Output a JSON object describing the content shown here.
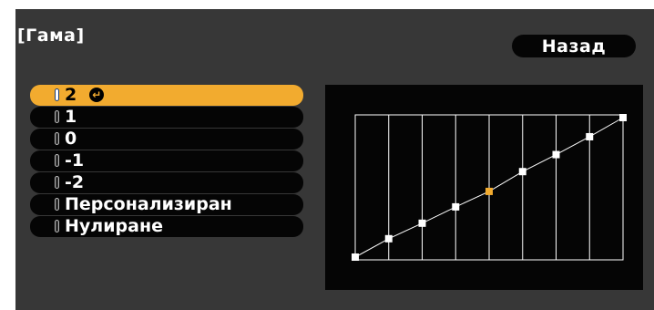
{
  "title": "[Гама]",
  "back_label": "Назад",
  "menu": {
    "items": [
      {
        "label": "2",
        "selected": true
      },
      {
        "label": "1",
        "selected": false
      },
      {
        "label": "0",
        "selected": false
      },
      {
        "label": "-1",
        "selected": false
      },
      {
        "label": "-2",
        "selected": false
      },
      {
        "label": "Персонализиран",
        "selected": false
      },
      {
        "label": "Нулиране",
        "selected": false
      }
    ]
  },
  "icons": {
    "enter": "enter-return-icon"
  },
  "colors": {
    "selected": "#f2ab2f",
    "background": "#373737",
    "item": "#050505",
    "active_point": "#f2ab2f"
  },
  "gamma_graph": {
    "columns": 8,
    "points": [
      {
        "x": 0,
        "y": 0.0,
        "active": false
      },
      {
        "x": 1,
        "y": 0.132,
        "active": false
      },
      {
        "x": 2,
        "y": 0.243,
        "active": false
      },
      {
        "x": 3,
        "y": 0.36,
        "active": false
      },
      {
        "x": 4,
        "y": 0.471,
        "active": true
      },
      {
        "x": 5,
        "y": 0.613,
        "active": false
      },
      {
        "x": 6,
        "y": 0.735,
        "active": false
      },
      {
        "x": 7,
        "y": 0.863,
        "active": false
      },
      {
        "x": 8,
        "y": 1.0,
        "active": false
      }
    ]
  }
}
